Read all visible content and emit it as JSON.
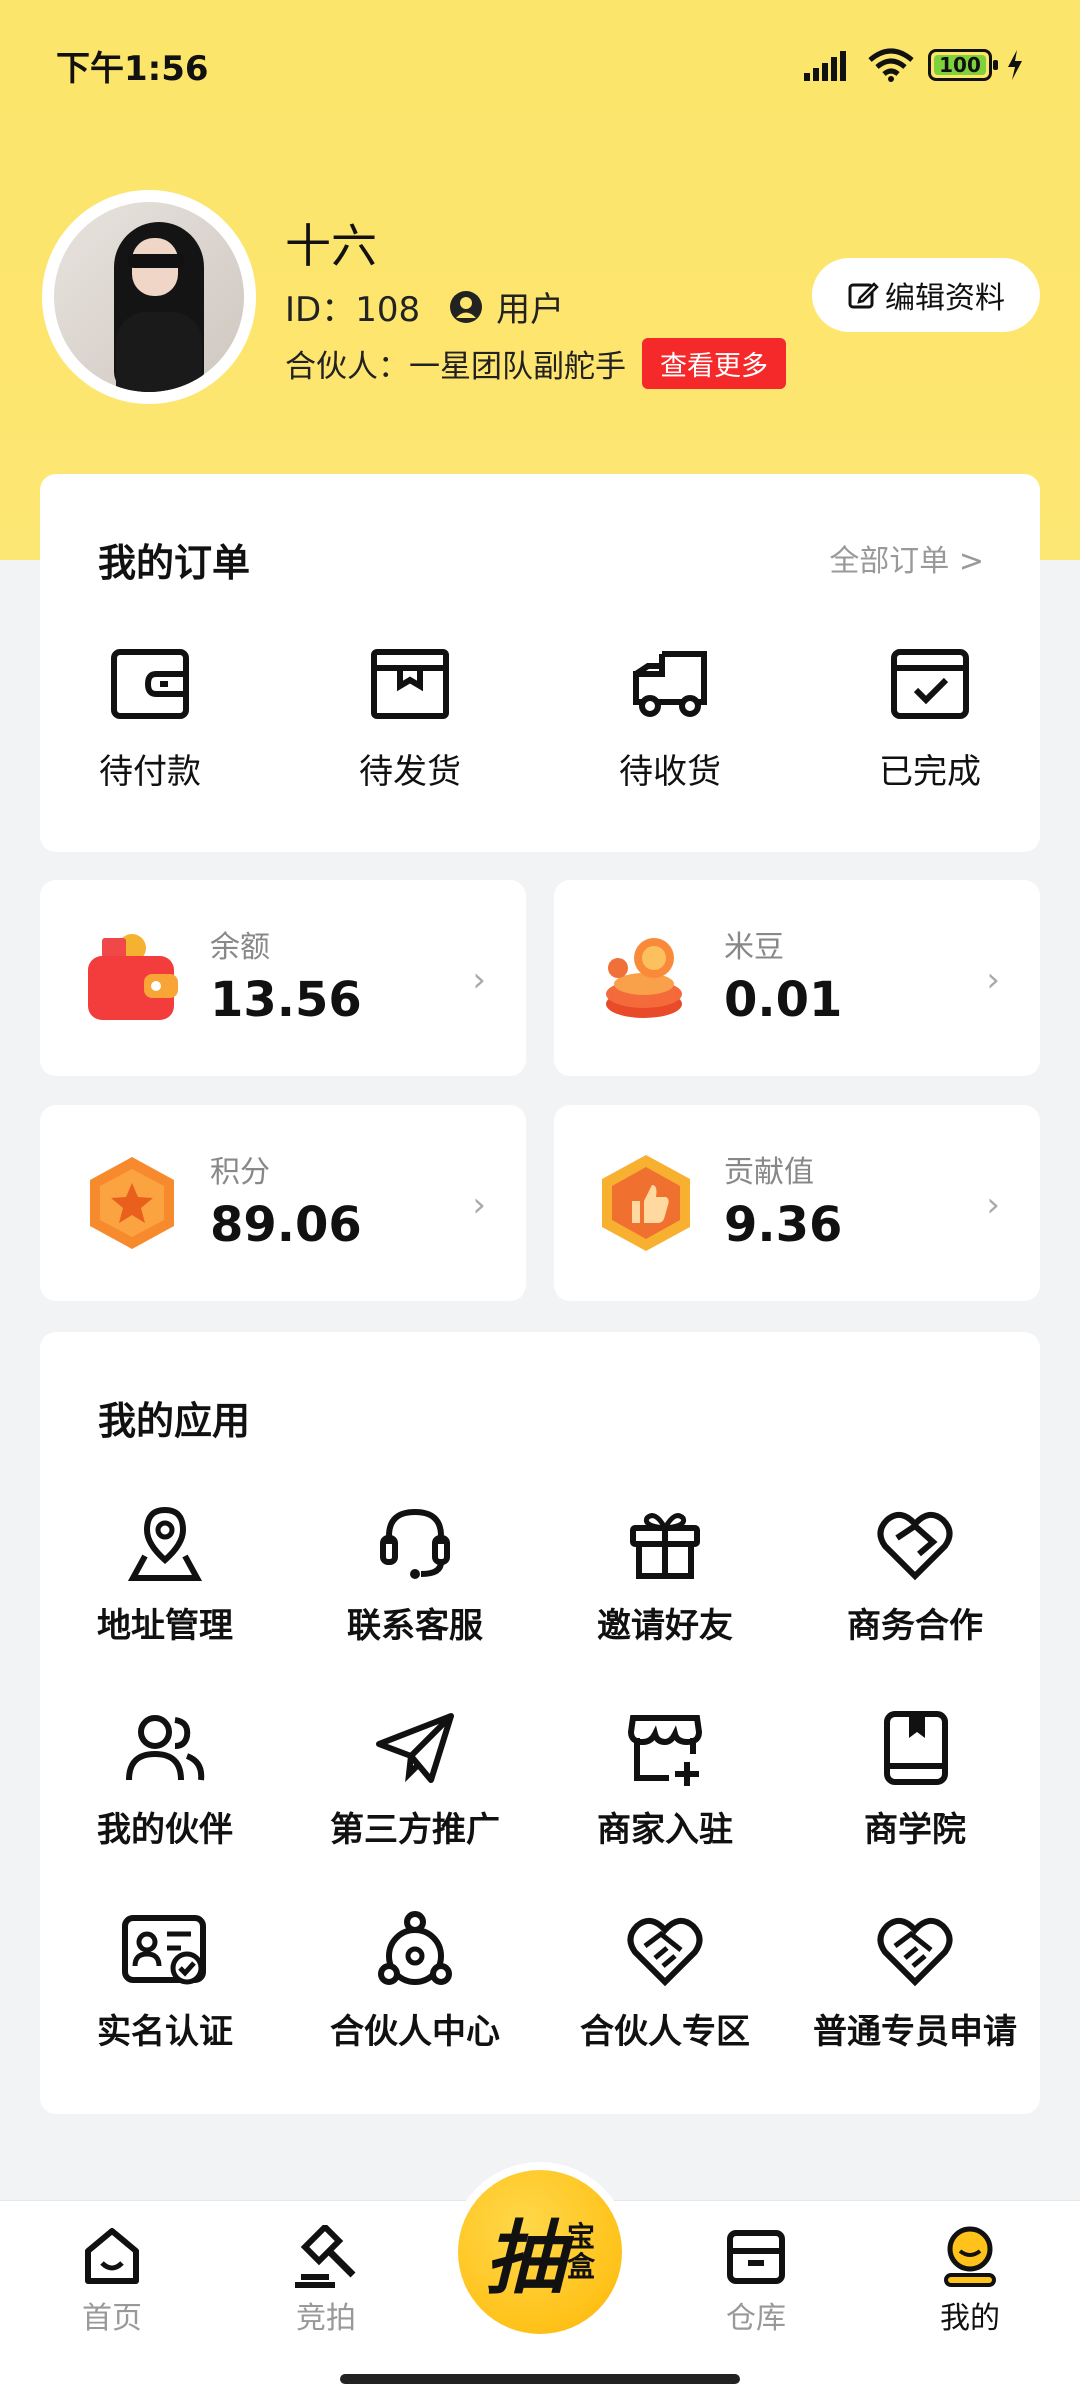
{
  "status": {
    "time": "下午1:56",
    "battery": "100"
  },
  "profile": {
    "name": "十六",
    "id_label": "ID：108",
    "role": "用户",
    "partner_label": "合伙人：一星团队副舵手",
    "more_button": "查看更多",
    "edit_button": "编辑资料"
  },
  "orders": {
    "title": "我的订单",
    "all_link": "全部订单 >",
    "items": [
      {
        "label": "待付款",
        "icon": "wallet-icon"
      },
      {
        "label": "待发货",
        "icon": "box-icon"
      },
      {
        "label": "待收货",
        "icon": "truck-icon"
      },
      {
        "label": "已完成",
        "icon": "check-box-icon"
      }
    ]
  },
  "stats": [
    {
      "label": "余额",
      "value": "13.56",
      "icon": "red-wallet-icon"
    },
    {
      "label": "米豆",
      "value": "0.01",
      "icon": "coins-icon"
    },
    {
      "label": "积分",
      "value": "89.06",
      "icon": "star-hexagon-icon"
    },
    {
      "label": "贡献值",
      "value": "9.36",
      "icon": "thumb-hexagon-icon"
    }
  ],
  "apps": {
    "title": "我的应用",
    "items": [
      {
        "label": "地址管理",
        "icon": "location-icon"
      },
      {
        "label": "联系客服",
        "icon": "headset-icon"
      },
      {
        "label": "邀请好友",
        "icon": "gift-icon"
      },
      {
        "label": "商务合作",
        "icon": "heart-handshake-icon"
      },
      {
        "label": "我的伙伴",
        "icon": "users-icon"
      },
      {
        "label": "第三方推广",
        "icon": "paper-plane-icon"
      },
      {
        "label": "商家入驻",
        "icon": "store-add-icon"
      },
      {
        "label": "商学院",
        "icon": "book-icon"
      },
      {
        "label": "实名认证",
        "icon": "id-card-icon"
      },
      {
        "label": "合伙人中心",
        "icon": "network-icon"
      },
      {
        "label": "合伙人专区",
        "icon": "handshake-icon"
      },
      {
        "label": "普通专员申请",
        "icon": "handshake-icon"
      }
    ]
  },
  "tabbar": {
    "home": "首页",
    "auction": "竞拍",
    "center_big": "抽",
    "center_small_1": "宝",
    "center_small_2": "盒",
    "warehouse": "仓库",
    "mine": "我的"
  }
}
